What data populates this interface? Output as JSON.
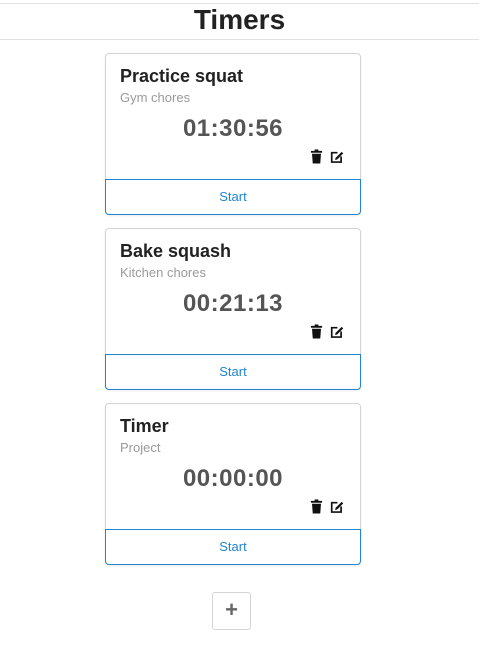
{
  "header": {
    "title": "Timers"
  },
  "timers": [
    {
      "title": "Practice squat",
      "project": "Gym chores",
      "elapsed": "01:30:56",
      "start_label": "Start"
    },
    {
      "title": "Bake squash",
      "project": "Kitchen chores",
      "elapsed": "00:21:13",
      "start_label": "Start"
    },
    {
      "title": "Timer",
      "project": "Project",
      "elapsed": "00:00:00",
      "start_label": "Start"
    }
  ],
  "icons": {
    "delete": "trash-icon",
    "edit": "edit-icon"
  },
  "add_button": {
    "label": "+"
  },
  "colors": {
    "accent": "#2185d0",
    "text": "#222222",
    "muted": "#9a9a9a",
    "border": "#d4d4d5"
  }
}
